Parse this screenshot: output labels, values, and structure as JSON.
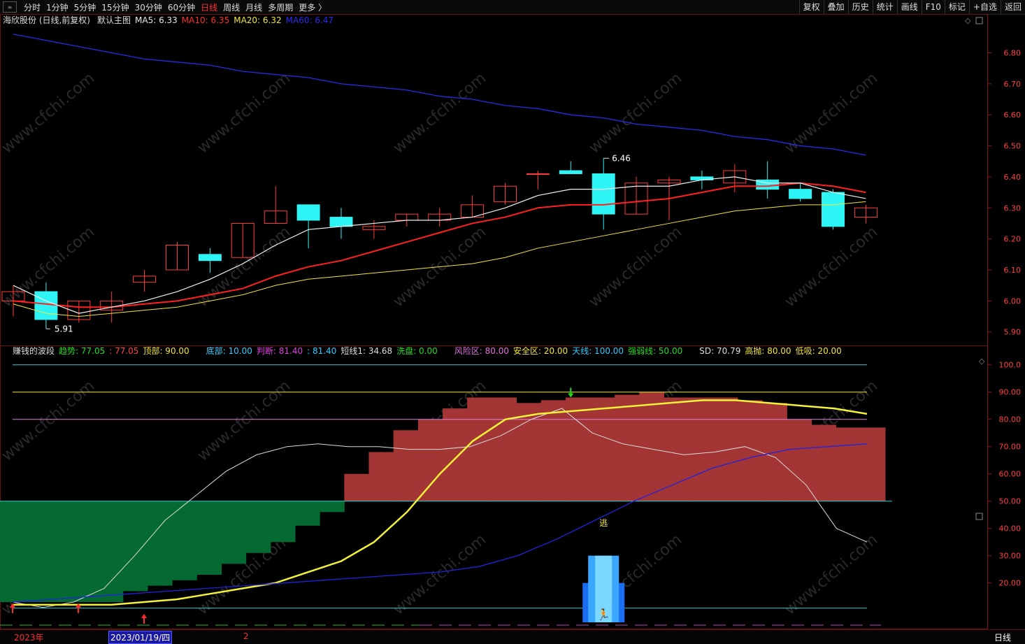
{
  "toolbar": {
    "sys_icon": "≡",
    "periods": [
      "分时",
      "1分钟",
      "5分钟",
      "15分钟",
      "30分钟",
      "60分钟",
      "日线",
      "周线",
      "月线",
      "多周期",
      "更多 〉"
    ],
    "active_period": "日线",
    "right": [
      "复权",
      "叠加",
      "历史",
      "统计",
      "画线",
      "F10",
      "标记",
      "+自选",
      "返回"
    ]
  },
  "main_legend": {
    "stock": "海欣股份 (日线,前复权)",
    "template": "默认主图",
    "ma": [
      {
        "label": "MA5: 6.33",
        "color": "#e8e8e8"
      },
      {
        "label": "MA10: 6.35",
        "color": "#ff2a2a"
      },
      {
        "label": "MA20: 6.32",
        "color": "#f2e63c"
      },
      {
        "label": "MA60: 6.47",
        "color": "#2a2af0"
      }
    ]
  },
  "sub_legend": {
    "title": "赚钱的波段",
    "items": [
      {
        "label": "趋势: 77.05",
        "color": "#22dd22"
      },
      {
        "label": ": 77.05",
        "color": "#ff4444"
      },
      {
        "label": "顶部: 90.00",
        "color": "#f2e63c"
      },
      {
        "label": "底部: 10.00",
        "color": "#33ccff"
      },
      {
        "label": "判断: 81.40",
        "color": "#e040e0"
      },
      {
        "label": ": 81.40",
        "color": "#33ccff"
      },
      {
        "label": "短线1: 34.68",
        "color": "#dddddd"
      },
      {
        "label": "洗盘: 0.00",
        "color": "#22dd22"
      },
      {
        "label": "风险区: 80.00",
        "color": "#e070e0"
      },
      {
        "label": "安全区: 20.00",
        "color": "#f2e63c"
      },
      {
        "label": "天线: 100.00",
        "color": "#33ccff"
      },
      {
        "label": "强弱线: 50.00",
        "color": "#22dd22"
      },
      {
        "label": "SD: 70.79",
        "color": "#dddddd"
      },
      {
        "label": "高抛: 80.00",
        "color": "#f2e63c"
      },
      {
        "label": "低吸: 20.00",
        "color": "#f2e63c"
      }
    ]
  },
  "axis": {
    "main_ticks": [
      "6.80",
      "6.70",
      "6.60",
      "6.50",
      "6.40",
      "6.30",
      "6.20",
      "6.10",
      "6.00",
      "5.90"
    ],
    "sub_ticks": [
      "100.0",
      "90.00",
      "80.00",
      "70.00",
      "60.00",
      "50.00",
      "40.00",
      "30.00",
      "20.00"
    ]
  },
  "annotations": {
    "high": "6.46",
    "low": "5.91",
    "escape": "逃"
  },
  "bottom": {
    "year": "2023年",
    "cursor_date": "2023/01/19/四",
    "marker": "2",
    "period": "日线"
  },
  "watermark": "www.cfchi.com",
  "chart_data": [
    {
      "type": "candlestick",
      "ylim": [
        5.87,
        6.88
      ],
      "candles": [
        {
          "o": 6.0,
          "h": 6.05,
          "l": 5.95,
          "c": 6.03,
          "dir": "up"
        },
        {
          "o": 6.03,
          "h": 6.06,
          "l": 5.91,
          "c": 5.94,
          "dir": "down"
        },
        {
          "o": 5.94,
          "h": 6.0,
          "l": 5.93,
          "c": 6.0,
          "dir": "up"
        },
        {
          "o": 5.97,
          "h": 6.03,
          "l": 5.93,
          "c": 6.0,
          "dir": "up"
        },
        {
          "o": 6.06,
          "h": 6.1,
          "l": 6.03,
          "c": 6.08,
          "dir": "up"
        },
        {
          "o": 6.1,
          "h": 6.19,
          "l": 6.1,
          "c": 6.18,
          "dir": "up"
        },
        {
          "o": 6.15,
          "h": 6.17,
          "l": 6.09,
          "c": 6.13,
          "dir": "down"
        },
        {
          "o": 6.14,
          "h": 6.25,
          "l": 6.14,
          "c": 6.25,
          "dir": "up"
        },
        {
          "o": 6.25,
          "h": 6.37,
          "l": 6.25,
          "c": 6.29,
          "dir": "up"
        },
        {
          "o": 6.31,
          "h": 6.31,
          "l": 6.17,
          "c": 6.26,
          "dir": "down"
        },
        {
          "o": 6.27,
          "h": 6.3,
          "l": 6.2,
          "c": 6.24,
          "dir": "down"
        },
        {
          "o": 6.23,
          "h": 6.26,
          "l": 6.2,
          "c": 6.24,
          "dir": "up"
        },
        {
          "o": 6.26,
          "h": 6.28,
          "l": 6.24,
          "c": 6.28,
          "dir": "up"
        },
        {
          "o": 6.26,
          "h": 6.3,
          "l": 6.24,
          "c": 6.28,
          "dir": "up"
        },
        {
          "o": 6.27,
          "h": 6.34,
          "l": 6.27,
          "c": 6.31,
          "dir": "up"
        },
        {
          "o": 6.32,
          "h": 6.38,
          "l": 6.31,
          "c": 6.37,
          "dir": "up"
        },
        {
          "o": 6.41,
          "h": 6.42,
          "l": 6.36,
          "c": 6.41,
          "dir": "up"
        },
        {
          "o": 6.42,
          "h": 6.45,
          "l": 6.41,
          "c": 6.41,
          "dir": "down"
        },
        {
          "o": 6.41,
          "h": 6.46,
          "l": 6.23,
          "c": 6.28,
          "dir": "down"
        },
        {
          "o": 6.28,
          "h": 6.4,
          "l": 6.28,
          "c": 6.38,
          "dir": "up"
        },
        {
          "o": 6.38,
          "h": 6.4,
          "l": 6.26,
          "c": 6.39,
          "dir": "up"
        },
        {
          "o": 6.4,
          "h": 6.42,
          "l": 6.36,
          "c": 6.39,
          "dir": "down"
        },
        {
          "o": 6.38,
          "h": 6.44,
          "l": 6.35,
          "c": 6.42,
          "dir": "up"
        },
        {
          "o": 6.39,
          "h": 6.45,
          "l": 6.33,
          "c": 6.36,
          "dir": "down"
        },
        {
          "o": 6.36,
          "h": 6.38,
          "l": 6.32,
          "c": 6.33,
          "dir": "down"
        },
        {
          "o": 6.35,
          "h": 6.36,
          "l": 6.23,
          "c": 6.24,
          "dir": "down"
        },
        {
          "o": 6.27,
          "h": 6.31,
          "l": 6.25,
          "c": 6.3,
          "dir": "up"
        }
      ],
      "ma5": [
        6.05,
        6.0,
        5.96,
        5.98,
        6.0,
        6.03,
        6.07,
        6.12,
        6.18,
        6.23,
        6.24,
        6.25,
        6.26,
        6.26,
        6.27,
        6.3,
        6.34,
        6.36,
        6.36,
        6.37,
        6.37,
        6.39,
        6.4,
        6.38,
        6.38,
        6.35,
        6.33
      ],
      "ma10": [
        6.0,
        5.99,
        5.98,
        5.98,
        5.99,
        6.0,
        6.02,
        6.04,
        6.08,
        6.11,
        6.13,
        6.16,
        6.19,
        6.22,
        6.25,
        6.27,
        6.3,
        6.31,
        6.31,
        6.32,
        6.33,
        6.35,
        6.37,
        6.37,
        6.38,
        6.37,
        6.35
      ],
      "ma20": [
        5.99,
        5.96,
        5.95,
        5.96,
        5.97,
        5.98,
        6.0,
        6.02,
        6.05,
        6.07,
        6.08,
        6.09,
        6.1,
        6.11,
        6.12,
        6.14,
        6.17,
        6.19,
        6.21,
        6.23,
        6.25,
        6.27,
        6.29,
        6.3,
        6.31,
        6.31,
        6.32
      ],
      "ma60": [
        6.86,
        6.84,
        6.82,
        6.8,
        6.78,
        6.77,
        6.76,
        6.74,
        6.73,
        6.72,
        6.7,
        6.69,
        6.68,
        6.66,
        6.65,
        6.63,
        6.62,
        6.6,
        6.59,
        6.57,
        6.56,
        6.55,
        6.53,
        6.52,
        6.5,
        6.49,
        6.47
      ]
    },
    {
      "type": "indicator",
      "ylim": [
        3,
        103
      ],
      "steps": [
        13,
        13,
        13,
        13,
        13,
        17,
        19,
        21,
        23,
        27,
        31,
        35,
        41,
        46,
        60,
        68,
        76,
        80,
        84,
        88,
        88,
        86,
        87,
        88,
        88,
        89,
        90,
        88,
        88,
        88,
        87,
        86,
        80,
        78,
        77,
        77
      ],
      "short": [
        13,
        11,
        13,
        18,
        30,
        43,
        52,
        61,
        67,
        70,
        71,
        70,
        70,
        69,
        69,
        70,
        74,
        80,
        84,
        75,
        71,
        69,
        67,
        68,
        70,
        66,
        56,
        40,
        35
      ],
      "trend": [
        12,
        12,
        12,
        12,
        13,
        14,
        16,
        18,
        20,
        24,
        28,
        35,
        46,
        60,
        72,
        80,
        82,
        83,
        84,
        85,
        86,
        87,
        87,
        86,
        85,
        84,
        82
      ],
      "sd": [
        13,
        14,
        15,
        16,
        17,
        18,
        19,
        20,
        21,
        22,
        23,
        24,
        26,
        30,
        36,
        43,
        50,
        56,
        62,
        66,
        69,
        70,
        71
      ],
      "top": 90,
      "bottom": 10,
      "risk": 80,
      "safe": 20,
      "sky": 100,
      "strong": 50,
      "escape_index": 18,
      "buy_arrow_indices": [
        0,
        2,
        4
      ],
      "sell_arrow_index": 17
    }
  ]
}
